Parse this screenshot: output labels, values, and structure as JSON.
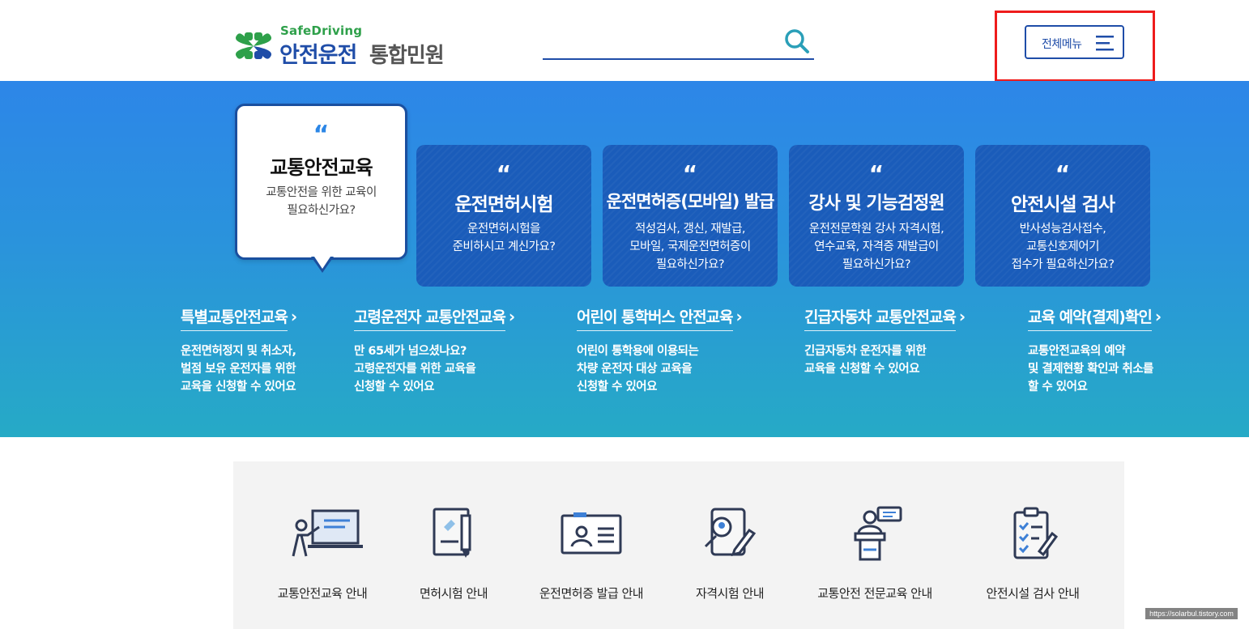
{
  "header": {
    "logo_en": "SafeDriving",
    "logo_ko_main": "안전운전",
    "logo_ko_sub": "통합민원",
    "search_placeholder": "",
    "all_menu_label": "전체메뉴",
    "colors": {
      "brand_blue": "#1f4da8",
      "brand_green": "#2ea04a",
      "highlight_red": "#ee1c1c"
    }
  },
  "hero": {
    "feature": {
      "quote": "“",
      "title": "교통안전교육",
      "desc_line1": "교통안전을 위한 교육이",
      "desc_line2": "필요하신가요?"
    },
    "cards": [
      {
        "quote": "“",
        "title": "운전면허시험",
        "lines": [
          "운전면허시험을",
          "준비하시고 계신가요?"
        ]
      },
      {
        "quote": "“",
        "title": "운전면허증(모바일) 발급",
        "lines": [
          "적성검사, 갱신, 재발급,",
          "모바일, 국제운전면허증이",
          "필요하신가요?"
        ]
      },
      {
        "quote": "“",
        "title": "강사 및 기능검정원",
        "lines": [
          "운전전문학원 강사 자격시험,",
          "연수교육, 자격증 재발급이",
          "필요하신가요?"
        ]
      },
      {
        "quote": "“",
        "title": "안전시설 검사",
        "lines": [
          "반사성능검사접수,",
          "교통신호제어기",
          "접수가 필요하신가요?"
        ]
      }
    ],
    "subs": [
      {
        "title": "특별교통안전교육",
        "lines": [
          "운전면허정지 및 취소자,",
          "벌점 보유 운전자를 위한",
          "교육을 신청할 수 있어요"
        ]
      },
      {
        "title": "고령운전자 교통안전교육",
        "lines": [
          "만 65세가 넘으셨나요?",
          "고령운전자를 위한 교육을",
          "신청할 수 있어요"
        ]
      },
      {
        "title": "어린이 통학버스 안전교육",
        "lines": [
          "어린이 통학용에 이용되는",
          "차량 운전자 대상 교육을",
          "신청할 수 있어요"
        ]
      },
      {
        "title": "긴급자동차 교통안전교육",
        "lines": [
          "긴급자동차 운전자를 위한",
          "교육을 신청할 수 있어요"
        ]
      },
      {
        "title": "교육 예약(결제)확인",
        "lines": [
          "교통안전교육의 예약",
          "및 결제현황 확인과 취소를",
          "할 수 있어요"
        ]
      }
    ],
    "arrow": "›"
  },
  "guide": {
    "items": [
      {
        "label": "교통안전교육 안내",
        "icon": "lecture-icon"
      },
      {
        "label": "면허시험 안내",
        "icon": "license-test-icon"
      },
      {
        "label": "운전면허증 발급 안내",
        "icon": "id-card-icon"
      },
      {
        "label": "자격시험 안내",
        "icon": "qualification-icon"
      },
      {
        "label": "교통안전 전문교육 안내",
        "icon": "podium-icon"
      },
      {
        "label": "안전시설 검사 안내",
        "icon": "checklist-icon"
      }
    ]
  },
  "watermark": "https://solarbul.tistory.com"
}
